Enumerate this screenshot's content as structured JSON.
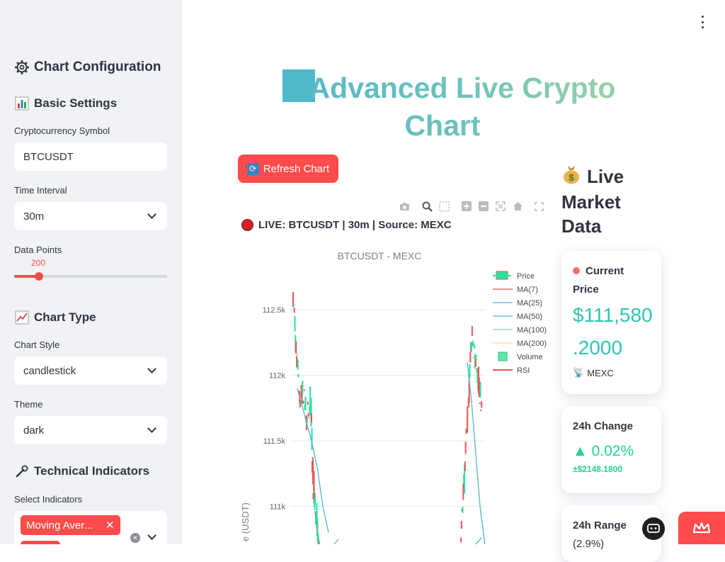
{
  "sidebar": {
    "config_title": "Chart Configuration",
    "basic_settings": "Basic Settings",
    "symbol_label": "Cryptocurrency Symbol",
    "symbol_value": "BTCUSDT",
    "interval_label": "Time Interval",
    "interval_value": "30m",
    "points_label": "Data Points",
    "points_value": "200",
    "points_fraction": 0.16,
    "chart_type": "Chart Type",
    "style_label": "Chart Style",
    "style_value": "candlestick",
    "theme_label": "Theme",
    "theme_value": "dark",
    "indicators_title": "Technical Indicators",
    "select_indicators_label": "Select Indicators",
    "indicator_tag_1": "Moving Aver..."
  },
  "main": {
    "title": "Advanced Live Crypto Chart",
    "refresh_label": "Refresh Chart",
    "live_title": "LIVE: BTCUSDT | 30m | Source: MEXC"
  },
  "chart_data": {
    "type": "line",
    "title": "BTCUSDT - MEXC",
    "ylabel": "e (USDT)",
    "y_ticks": [
      "112.5k",
      "112k",
      "111.5k",
      "111k"
    ],
    "ylim": [
      110700,
      112700
    ],
    "legend": [
      "Price",
      "MA(7)",
      "MA(25)",
      "MA(50)",
      "MA(100)",
      "MA(200)",
      "Volume",
      "RSI"
    ],
    "legend_placement": "top-right",
    "series": [
      {
        "name": "Price",
        "color": "#ef5350",
        "values": [
          112620,
          112150,
          111850,
          111900,
          111600,
          111800,
          111250,
          111050,
          110850,
          110700
        ]
      },
      {
        "name": "Price",
        "color": "#26e3a0",
        "values": [
          110700,
          111200,
          111800,
          112300,
          112200,
          111900,
          111700
        ]
      },
      {
        "name": "MA(25)",
        "color": "#4fb7c9",
        "values": [
          111900,
          111700,
          111500,
          111300,
          111000,
          110800
        ]
      }
    ]
  },
  "market": {
    "heading_line1": "Live",
    "heading_line2": "Market",
    "heading_line3": "Data",
    "price_label": "Current Price",
    "price_value_1": "$111,580",
    "price_value_2": ".2000",
    "source": "MEXC",
    "change_label": "24h Change",
    "change_value": "▲ 0.02%",
    "change_sub": "±$2148.1800",
    "range_label": "24h Range",
    "range_value": "(2.9%)"
  },
  "colors": {
    "accent": "#ff4b4b",
    "teal": "#2fc4b2",
    "green": "#1fd39a",
    "sidebar_bg": "#f0f2f6"
  }
}
